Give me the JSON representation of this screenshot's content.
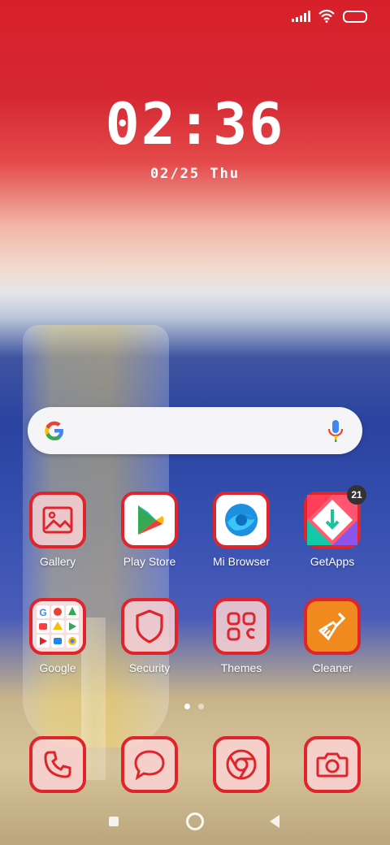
{
  "status": {
    "icons": [
      "signal-icon",
      "wifi-icon",
      "battery-icon"
    ]
  },
  "lock": {
    "time": "02:36",
    "date": "02/25 Thu"
  },
  "search": {
    "icons": [
      "google-g-icon",
      "mic-icon"
    ]
  },
  "apps_row1": [
    {
      "label": "Gallery",
      "icon": "gallery-icon"
    },
    {
      "label": "Play Store",
      "icon": "play-store-icon"
    },
    {
      "label": "Mi Browser",
      "icon": "mi-browser-icon"
    },
    {
      "label": "GetApps",
      "icon": "getapps-icon",
      "badge": "21"
    }
  ],
  "apps_row2": [
    {
      "label": "Google",
      "icon": "google-folder-icon"
    },
    {
      "label": "Security",
      "icon": "shield-icon"
    },
    {
      "label": "Themes",
      "icon": "themes-icon"
    },
    {
      "label": "Cleaner",
      "icon": "broom-icon"
    }
  ],
  "dock": [
    {
      "icon": "phone-icon"
    },
    {
      "icon": "messages-icon"
    },
    {
      "icon": "chrome-icon"
    },
    {
      "icon": "camera-icon"
    }
  ],
  "pager": {
    "pages": 2,
    "current": 1
  },
  "colors": {
    "accent": "#e0242c",
    "tile_bg": "#fad2d2"
  }
}
